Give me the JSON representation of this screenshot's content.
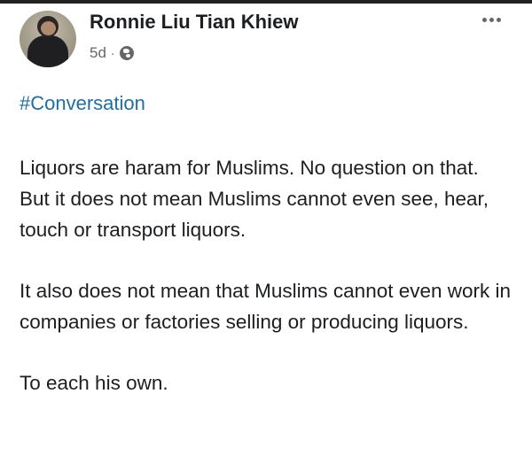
{
  "post": {
    "author_name": "Ronnie Liu Tian Khiew",
    "time_ago": "5d",
    "separator": "·",
    "privacy_icon": "globe-icon",
    "more_icon": "more-options-icon",
    "hashtag": "#Conversation",
    "paragraphs": [
      "Liquors are haram for Muslims. No question on that.",
      "But it does not mean Muslims cannot even see, hear, touch or transport liquors.",
      "It also does not mean that Muslims cannot even work in companies or factories selling or producing  liquors.",
      "To each his own."
    ]
  },
  "colors": {
    "hashtag": "#1d6fa5",
    "secondary_text": "#65676b",
    "primary_text": "#1c1e21"
  }
}
